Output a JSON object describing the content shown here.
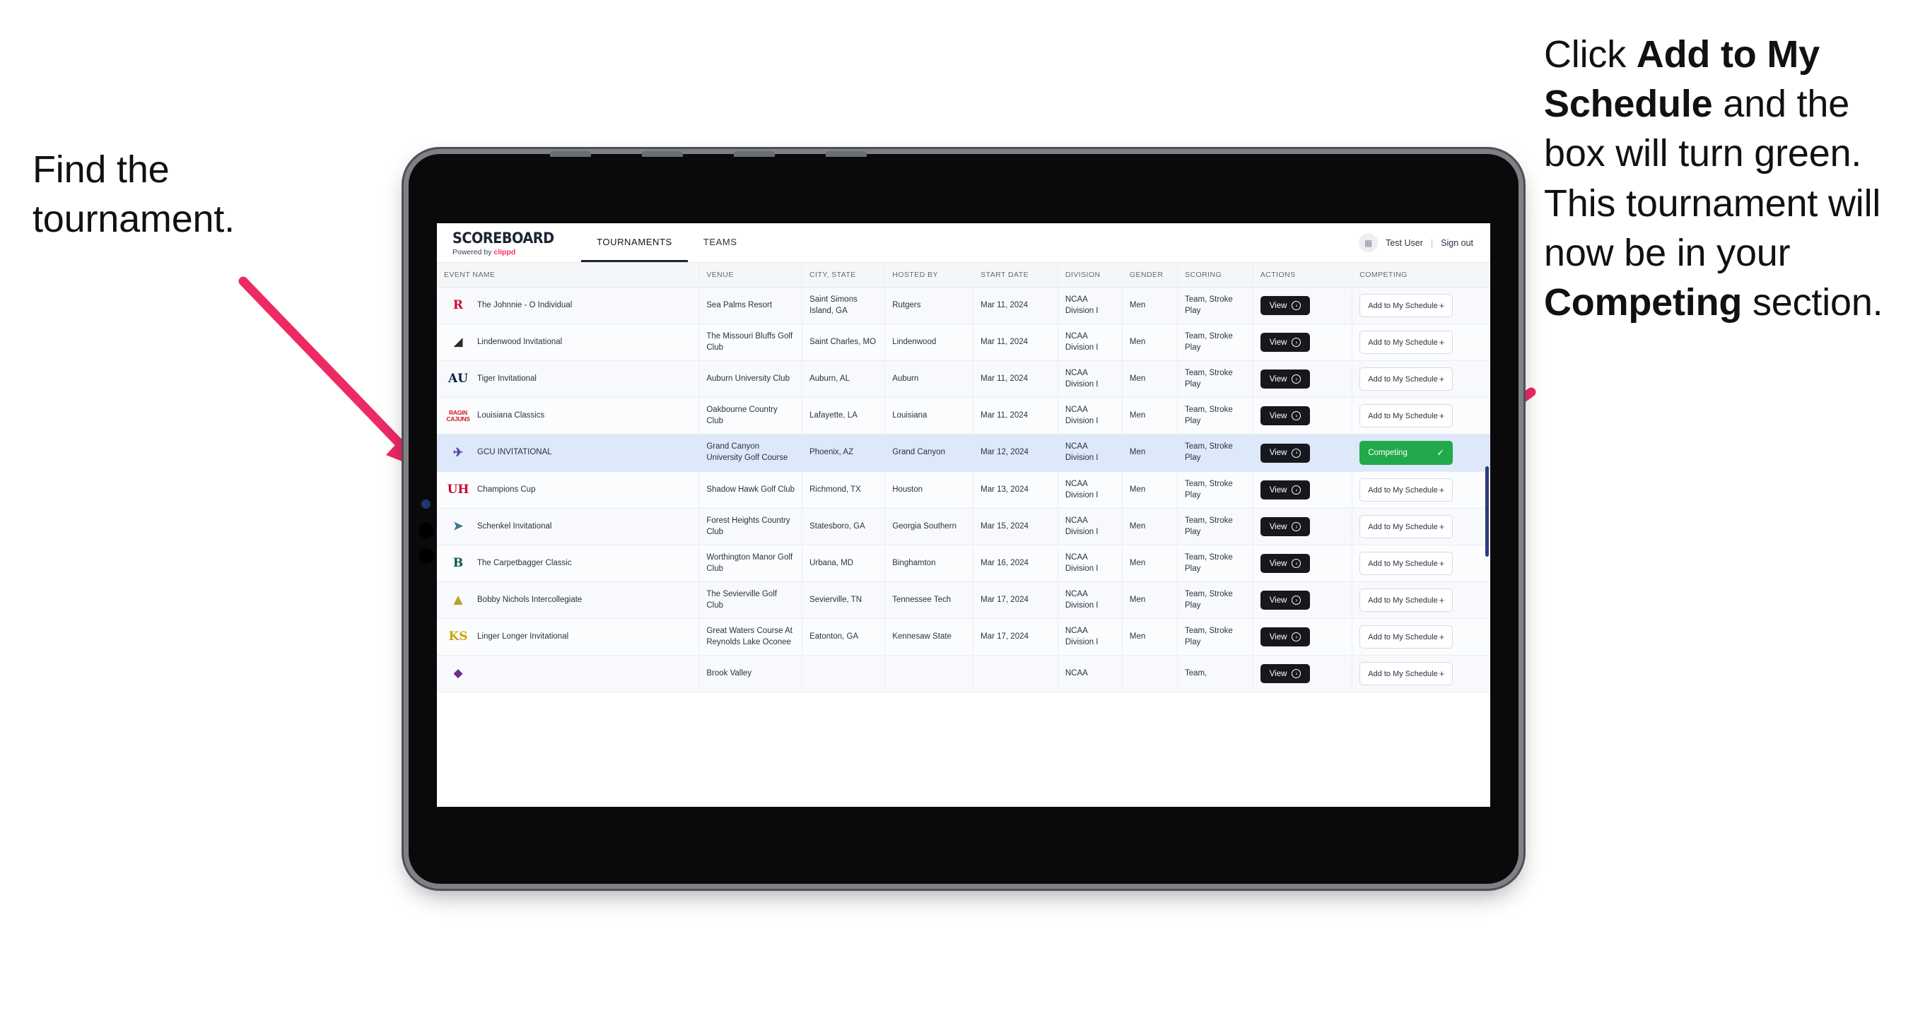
{
  "annotations": {
    "left": {
      "text": "Find the tournament."
    },
    "right": {
      "part1": "Click ",
      "bold1": "Add to My Schedule",
      "part2": " and the box will turn green. This tournament will now be in your ",
      "bold2": "Competing",
      "part3": " section."
    },
    "arrow_color": "#ED2A63"
  },
  "app": {
    "brand": {
      "title": "SCOREBOARD",
      "powered_prefix": "Powered by ",
      "powered_brand": "clippd"
    },
    "tabs": [
      {
        "label": "TOURNAMENTS",
        "active": true
      },
      {
        "label": "TEAMS",
        "active": false
      }
    ],
    "header_right": {
      "avatar_icon": "user-avatar-icon",
      "user_name": "Test User",
      "separator": "|",
      "sign_out": "Sign out"
    }
  },
  "table": {
    "columns": [
      "EVENT NAME",
      "VENUE",
      "CITY, STATE",
      "HOSTED BY",
      "START DATE",
      "DIVISION",
      "GENDER",
      "SCORING",
      "ACTIONS",
      "COMPETING"
    ],
    "view_label": "View",
    "add_label": "Add to My Schedule",
    "add_icon": "plus-icon",
    "competing_label": "Competing",
    "competing_icon": "check-icon",
    "competing_color": "#22a94b",
    "rows": [
      {
        "logo": "R",
        "logo_color": "#c8102e",
        "logo_bg": "transparent",
        "event": "The Johnnie - O Individual",
        "venue": "Sea Palms Resort",
        "city": "Saint Simons Island, GA",
        "host": "Rutgers",
        "date": "Mar 11, 2024",
        "division": "NCAA Division I",
        "gender": "Men",
        "scoring": "Team, Stroke Play",
        "competing": false
      },
      {
        "logo": "◢",
        "logo_color": "#2b2b2b",
        "logo_bg": "transparent",
        "event": "Lindenwood Invitational",
        "venue": "The Missouri Bluffs Golf Club",
        "city": "Saint Charles, MO",
        "host": "Lindenwood",
        "date": "Mar 11, 2024",
        "division": "NCAA Division I",
        "gender": "Men",
        "scoring": "Team, Stroke Play",
        "competing": false
      },
      {
        "logo": "AU",
        "logo_color": "#0c2340",
        "logo_bg": "transparent",
        "event": "Tiger Invitational",
        "venue": "Auburn University Club",
        "city": "Auburn, AL",
        "host": "Auburn",
        "date": "Mar 11, 2024",
        "division": "NCAA Division I",
        "gender": "Men",
        "scoring": "Team, Stroke Play",
        "competing": false
      },
      {
        "logo": "RAGIN CAJUNS",
        "logo_color": "#ce181e",
        "logo_bg": "transparent",
        "event": "Louisiana Classics",
        "venue": "Oakbourne Country Club",
        "city": "Lafayette, LA",
        "host": "Louisiana",
        "date": "Mar 11, 2024",
        "division": "NCAA Division I",
        "gender": "Men",
        "scoring": "Team, Stroke Play",
        "competing": false
      },
      {
        "logo": "✈",
        "logo_color": "#5d3fa8",
        "logo_bg": "transparent",
        "event": "GCU INVITATIONAL",
        "venue": "Grand Canyon University Golf Course",
        "city": "Phoenix, AZ",
        "host": "Grand Canyon",
        "date": "Mar 12, 2024",
        "division": "NCAA Division I",
        "gender": "Men",
        "scoring": "Team, Stroke Play",
        "competing": true
      },
      {
        "logo": "UH",
        "logo_color": "#c8102e",
        "logo_bg": "transparent",
        "event": "Champions Cup",
        "venue": "Shadow Hawk Golf Club",
        "city": "Richmond, TX",
        "host": "Houston",
        "date": "Mar 13, 2024",
        "division": "NCAA Division I",
        "gender": "Men",
        "scoring": "Team, Stroke Play",
        "competing": false
      },
      {
        "logo": "➤",
        "logo_color": "#41748d",
        "logo_bg": "transparent",
        "event": "Schenkel Invitational",
        "venue": "Forest Heights Country Club",
        "city": "Statesboro, GA",
        "host": "Georgia Southern",
        "date": "Mar 15, 2024",
        "division": "NCAA Division I",
        "gender": "Men",
        "scoring": "Team, Stroke Play",
        "competing": false
      },
      {
        "logo": "B",
        "logo_color": "#005a43",
        "logo_bg": "transparent",
        "event": "The Carpetbagger Classic",
        "venue": "Worthington Manor Golf Club",
        "city": "Urbana, MD",
        "host": "Binghamton",
        "date": "Mar 16, 2024",
        "division": "NCAA Division I",
        "gender": "Men",
        "scoring": "Team, Stroke Play",
        "competing": false
      },
      {
        "logo": "▲",
        "logo_color": "#b8a22c",
        "logo_bg": "transparent",
        "event": "Bobby Nichols Intercollegiate",
        "venue": "The Sevierville Golf Club",
        "city": "Sevierville, TN",
        "host": "Tennessee Tech",
        "date": "Mar 17, 2024",
        "division": "NCAA Division I",
        "gender": "Men",
        "scoring": "Team, Stroke Play",
        "competing": false
      },
      {
        "logo": "KS",
        "logo_color": "#c8a408",
        "logo_bg": "transparent",
        "event": "Linger Longer Invitational",
        "venue": "Great Waters Course At Reynolds Lake Oconee",
        "city": "Eatonton, GA",
        "host": "Kennesaw State",
        "date": "Mar 17, 2024",
        "division": "NCAA Division I",
        "gender": "Men",
        "scoring": "Team, Stroke Play",
        "competing": false
      },
      {
        "logo": "◆",
        "logo_color": "#6a2c8f",
        "logo_bg": "transparent",
        "event": "",
        "venue": "Brook Valley",
        "city": "",
        "host": "",
        "date": "",
        "division": "NCAA",
        "gender": "",
        "scoring": "Team,",
        "competing": false
      }
    ]
  }
}
